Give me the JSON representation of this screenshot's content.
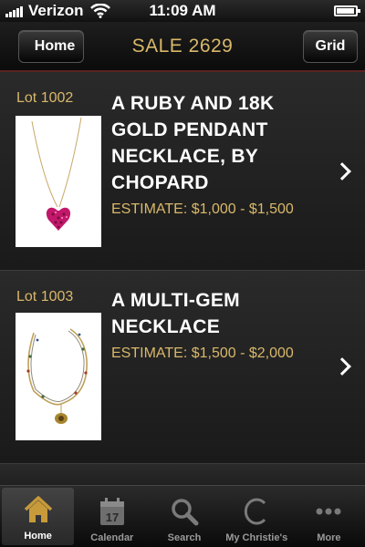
{
  "status_bar": {
    "carrier": "Verizon",
    "time": "11:09 AM"
  },
  "nav": {
    "back_label": "Home",
    "title": "SALE 2629",
    "grid_label": "Grid"
  },
  "lots": [
    {
      "number": "Lot 1002",
      "title_lines": [
        "A RUBY AND 18K",
        "GOLD PENDANT",
        "NECKLACE, BY",
        "CHOPARD"
      ],
      "estimate": "ESTIMATE: $1,000 - $1,500",
      "image": "ruby-heart-pendant-necklace"
    },
    {
      "number": "Lot 1003",
      "title_lines": [
        "A MULTI-GEM",
        "NECKLACE"
      ],
      "estimate": "ESTIMATE: $1,500 - $2,000",
      "image": "multi-gem-necklace"
    }
  ],
  "tabs": [
    {
      "label": "Home",
      "icon": "house-icon",
      "active": true
    },
    {
      "label": "Calendar",
      "icon": "calendar-icon",
      "calendar_day": "17",
      "active": false
    },
    {
      "label": "Search",
      "icon": "magnifier-icon",
      "active": false
    },
    {
      "label": "My Christie's",
      "icon": "christies-c-icon",
      "active": false
    },
    {
      "label": "More",
      "icon": "more-dots-icon",
      "active": false
    }
  ],
  "colors": {
    "accent_gold": "#d9b86a",
    "background": "#1c1c1c",
    "nav_divider": "#5a2320"
  }
}
